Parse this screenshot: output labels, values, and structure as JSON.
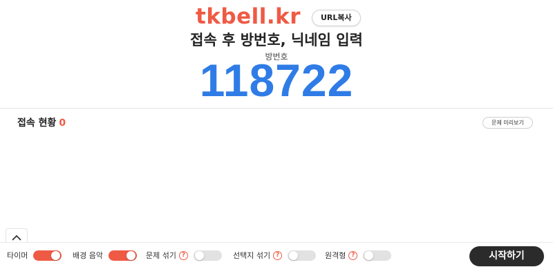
{
  "header": {
    "brand": "tkbell.kr",
    "url_copy_label": "URL복사",
    "instruction": "접속 후 방번호, 닉네임 입력",
    "room_label": "방번호",
    "room_number": "118722"
  },
  "status": {
    "label": "접속 현황",
    "count": "0",
    "preview_label": "문제 미리보기"
  },
  "options": [
    {
      "label": "타이머",
      "on": true,
      "help": false
    },
    {
      "label": "배경 음악",
      "on": true,
      "help": false
    },
    {
      "label": "문제 섞기",
      "on": false,
      "help": true
    },
    {
      "label": "선택지 섞기",
      "on": false,
      "help": true
    },
    {
      "label": "원격형",
      "on": false,
      "help": true
    }
  ],
  "help_glyph": "?",
  "start_label": "시작하기",
  "colors": {
    "accent": "#ef5a45",
    "room_number": "#2f7ce6",
    "start_button": "#2b2b2b"
  }
}
